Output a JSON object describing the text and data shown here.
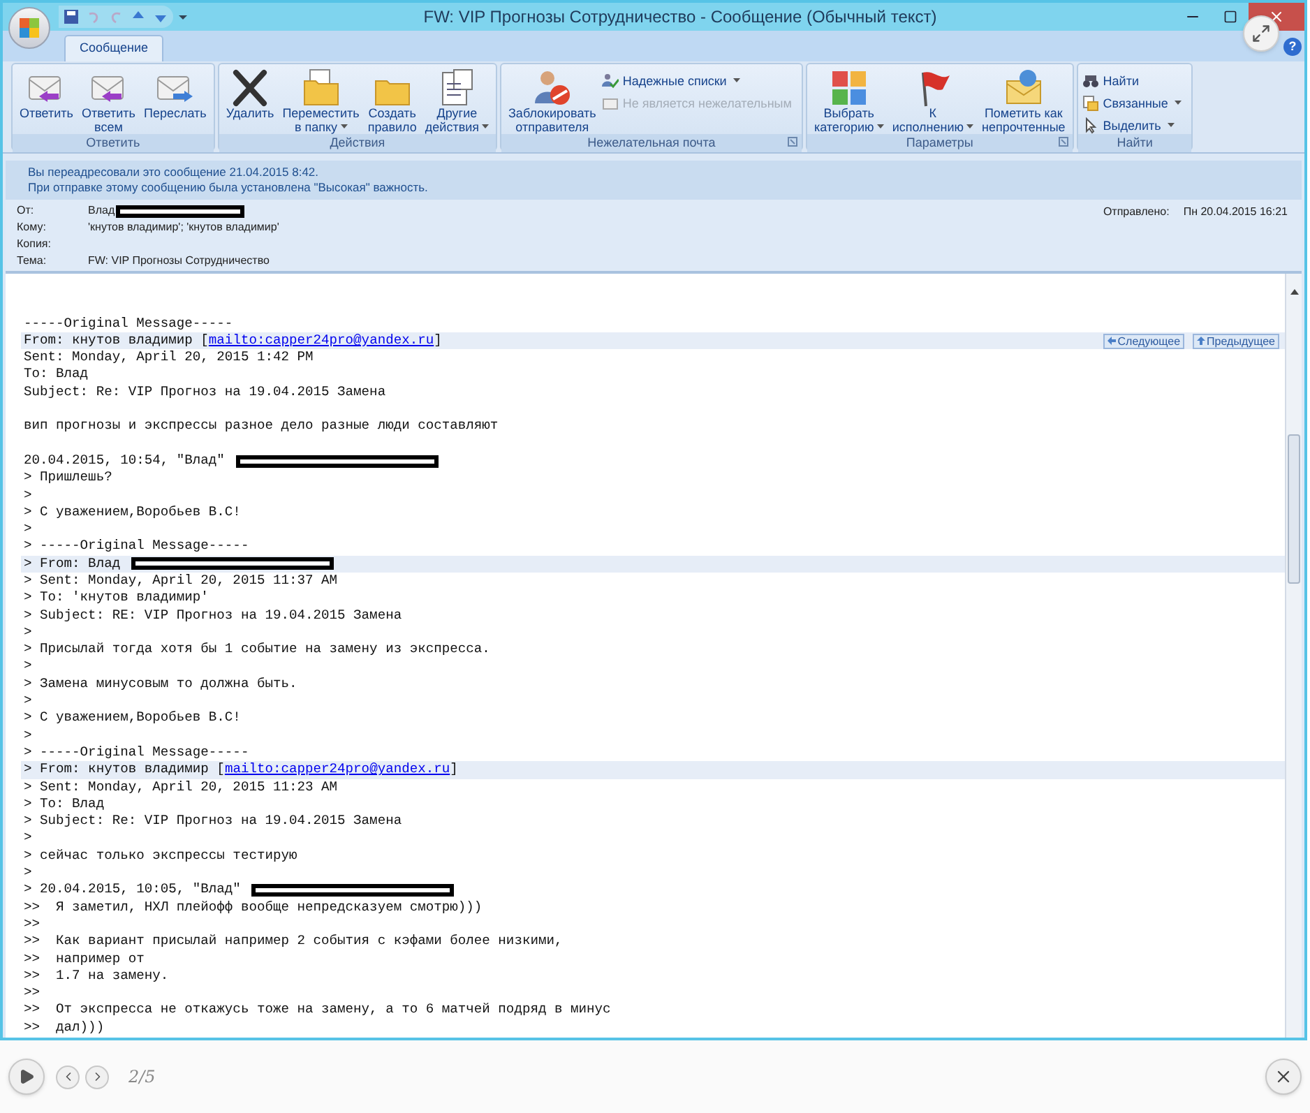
{
  "window": {
    "title": "FW: VIP  Прогнозы Сотрудничество - Сообщение (Обычный текст)"
  },
  "tabs": [
    {
      "label": "Сообщение",
      "selected": true
    }
  ],
  "help": {
    "label": "?"
  },
  "ribbon": [
    {
      "label": "Ответить",
      "launcher": false,
      "buttons": [
        {
          "kind": "large",
          "label": "Ответить",
          "menu": false,
          "disabled": false
        },
        {
          "kind": "large",
          "label": "Ответить",
          "label2": "всем",
          "menu": false,
          "disabled": false
        },
        {
          "kind": "large",
          "label": "Переслать",
          "menu": false,
          "disabled": false
        }
      ]
    },
    {
      "label": "Действия",
      "launcher": false,
      "buttons": [
        {
          "kind": "large",
          "label": "Удалить",
          "menu": false,
          "disabled": false
        },
        {
          "kind": "large",
          "label": "Переместить",
          "label2": "в папку",
          "menu": true,
          "disabled": false
        },
        {
          "kind": "large",
          "label": "Создать",
          "label2": "правило",
          "menu": false,
          "disabled": false
        },
        {
          "kind": "large",
          "label": "Другие",
          "label2": "действия",
          "menu": true,
          "disabled": false
        }
      ]
    },
    {
      "label": "Нежелательная почта",
      "launcher": true,
      "buttons": [
        {
          "kind": "large",
          "label": "Заблокировать",
          "label2": "отправителя",
          "menu": false,
          "disabled": false
        },
        {
          "kind": "small",
          "label": "Надежные списки",
          "menu": true,
          "disabled": false
        },
        {
          "kind": "small",
          "label": "Не является нежелательным",
          "menu": false,
          "disabled": true
        }
      ]
    },
    {
      "label": "Параметры",
      "launcher": true,
      "buttons": [
        {
          "kind": "large",
          "label": "Выбрать",
          "label2": "категорию",
          "menu": true,
          "disabled": false
        },
        {
          "kind": "large",
          "label": "К",
          "label2": "исполнению",
          "menu": true,
          "disabled": false
        },
        {
          "kind": "large",
          "label": "Пометить как",
          "label2": "непрочтенные",
          "menu": false,
          "disabled": false
        }
      ]
    },
    {
      "label": "Найти",
      "launcher": false,
      "buttons": [
        {
          "kind": "small",
          "label": "Найти",
          "menu": false,
          "disabled": false
        },
        {
          "kind": "small",
          "label": "Связанные",
          "menu": true,
          "disabled": false
        },
        {
          "kind": "small",
          "label": "Выделить",
          "menu": true,
          "disabled": false
        }
      ]
    }
  ],
  "info_bar": [
    "Вы переадресовали это сообщение 21.04.2015 8:42.",
    "При отправке этому сообщению была установлена \"Высокая\" важность."
  ],
  "headers": [
    {
      "label": "От:",
      "value": "Влад",
      "redacted": true
    },
    {
      "label": "Кому:",
      "value": "'кнутов владимир'; 'кнутов владимир'",
      "redacted": false
    },
    {
      "label": "Копия:",
      "redacted": false
    },
    {
      "label": "Тема:",
      "value": "FW: VIP  Прогнозы Сотрудничество",
      "redacted": false
    }
  ],
  "sent": {
    "label": "Отправлено:",
    "value": "Пн 20.04.2015 16:21"
  },
  "body": {
    "lines": [
      {
        "kind": "blank"
      },
      {
        "kind": "blank"
      },
      {
        "kind": "text",
        "text": "-----Original Message-----",
        "band": false,
        "redacted": false
      },
      {
        "kind": "text",
        "text": "From: кнутов владимир [",
        "link": "mailto:capper24pro@yandex.ru",
        "tail": "]",
        "band": true,
        "redacted": false,
        "buttons": [
          "Следующее",
          "Предыдущее"
        ]
      },
      {
        "kind": "text",
        "text": "Sent: Monday, April 20, 2015 1:42 PM",
        "band": false,
        "redacted": false
      },
      {
        "kind": "text",
        "text": "To: Влад",
        "band": false,
        "redacted": false
      },
      {
        "kind": "text",
        "text": "Subject: Re: VIP Прогноз на 19.04.2015 Замена",
        "band": false,
        "redacted": false
      },
      {
        "kind": "blank"
      },
      {
        "kind": "text",
        "text": "вип прогнозы и экспрессы разное дело разные люди составляют",
        "band": false,
        "redacted": false
      },
      {
        "kind": "blank"
      },
      {
        "kind": "text",
        "text": "20.04.2015, 10:54, \"Влад\"",
        "band": false,
        "redacted": true
      },
      {
        "kind": "text",
        "text": "> Пришлешь?",
        "band": false,
        "redacted": false
      },
      {
        "kind": "text",
        "text": ">",
        "band": false,
        "redacted": false
      },
      {
        "kind": "text",
        "text": "> С уважением,Воробьев В.С!",
        "band": false,
        "redacted": false
      },
      {
        "kind": "text",
        "text": ">",
        "band": false,
        "redacted": false
      },
      {
        "kind": "text",
        "text": "> -----Original Message-----",
        "band": false,
        "redacted": false
      },
      {
        "kind": "text",
        "text": "> From: Влад",
        "band": true,
        "redacted": true
      },
      {
        "kind": "text",
        "text": "> Sent: Monday, April 20, 2015 11:37 AM",
        "band": false,
        "redacted": false
      },
      {
        "kind": "text",
        "text": "> To: 'кнутов владимир'",
        "band": false,
        "redacted": false
      },
      {
        "kind": "text",
        "text": "> Subject: RE: VIP Прогноз на 19.04.2015 Замена",
        "band": false,
        "redacted": false
      },
      {
        "kind": "text",
        "text": ">",
        "band": false,
        "redacted": false
      },
      {
        "kind": "text",
        "text": "> Присылай тогда хотя бы 1 событие на замену из экспресса.",
        "band": false,
        "redacted": false
      },
      {
        "kind": "text",
        "text": ">",
        "band": false,
        "redacted": false
      },
      {
        "kind": "text",
        "text": "> Замена минусовым то должна быть.",
        "band": false,
        "redacted": false
      },
      {
        "kind": "text",
        "text": ">",
        "band": false,
        "redacted": false
      },
      {
        "kind": "text",
        "text": "> С уважением,Воробьев В.С!",
        "band": false,
        "redacted": false
      },
      {
        "kind": "text",
        "text": ">",
        "band": false,
        "redacted": false
      },
      {
        "kind": "text",
        "text": "> -----Original Message-----",
        "band": false,
        "redacted": false
      },
      {
        "kind": "text",
        "text": "> From: кнутов владимир [",
        "link": "mailto:capper24pro@yandex.ru",
        "tail": "]",
        "band": true,
        "redacted": false
      },
      {
        "kind": "text",
        "text": "> Sent: Monday, April 20, 2015 11:23 AM",
        "band": false,
        "redacted": false
      },
      {
        "kind": "text",
        "text": "> To: Влад",
        "band": false,
        "redacted": false
      },
      {
        "kind": "text",
        "text": "> Subject: Re: VIP Прогноз на 19.04.2015 Замена",
        "band": false,
        "redacted": false
      },
      {
        "kind": "text",
        "text": ">",
        "band": false,
        "redacted": false
      },
      {
        "kind": "text",
        "text": "> сейчас только экспрессы тестирую",
        "band": false,
        "redacted": false
      },
      {
        "kind": "text",
        "text": ">",
        "band": false,
        "redacted": false
      },
      {
        "kind": "text",
        "text": "> 20.04.2015, 10:05, \"Влад\"",
        "band": false,
        "redacted": true
      },
      {
        "kind": "text",
        "text": ">>  Я заметил, НХЛ плейофф вообще непредсказуем смотрю)))",
        "band": false,
        "redacted": false
      },
      {
        "kind": "text",
        "text": ">>",
        "band": false,
        "redacted": false
      },
      {
        "kind": "text",
        "text": ">>  Как вариант присылай например 2 события с кэфами более низкими,",
        "band": false,
        "redacted": false
      },
      {
        "kind": "text",
        "text": ">>  например от",
        "band": false,
        "redacted": false
      },
      {
        "kind": "text",
        "text": ">>  1.7 на замену.",
        "band": false,
        "redacted": false
      },
      {
        "kind": "text",
        "text": ">>",
        "band": false,
        "redacted": false
      },
      {
        "kind": "text",
        "text": ">>  От экспресса не откажусь тоже на замену, а то 6 матчей подряд в минус",
        "band": false,
        "redacted": false
      },
      {
        "kind": "text",
        "text": ">>  дал)))",
        "band": false,
        "redacted": false
      }
    ]
  },
  "viewer": {
    "counter": "2/5"
  }
}
